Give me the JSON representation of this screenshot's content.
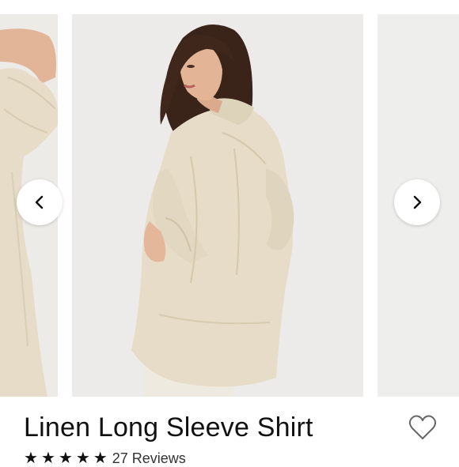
{
  "product": {
    "title": "Linen Long Sleeve Shirt",
    "rating_stars": 5,
    "reviews_text": "27 Reviews"
  },
  "carousel": {
    "prev_icon": "chevron-left-icon",
    "next_icon": "chevron-right-icon"
  },
  "actions": {
    "favorite_icon": "heart-outline-icon"
  },
  "colors": {
    "shirt": "#e6dcc7",
    "background": "#ecebe9"
  }
}
